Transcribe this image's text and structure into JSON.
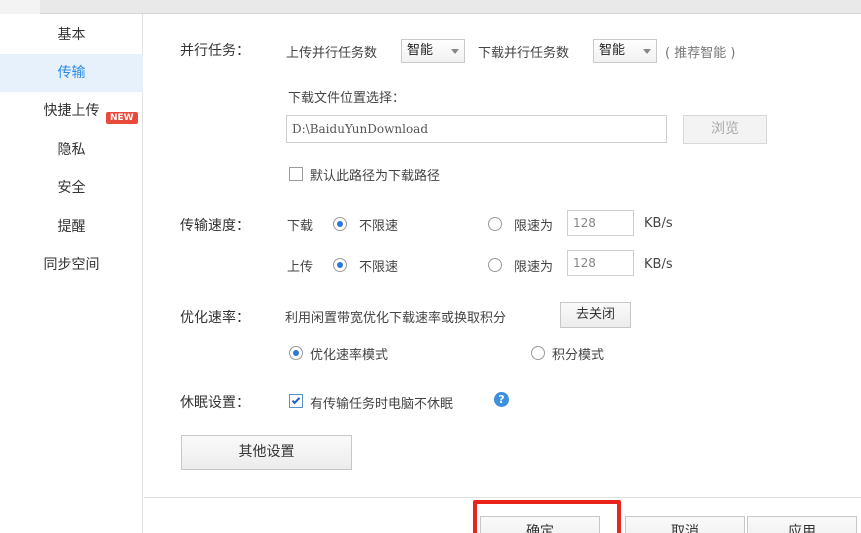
{
  "sidebar": {
    "items": [
      {
        "label": "基本"
      },
      {
        "label": "传输",
        "active": true
      },
      {
        "label": "快捷上传",
        "badge": "NEW"
      },
      {
        "label": "隐私"
      },
      {
        "label": "安全"
      },
      {
        "label": "提醒"
      },
      {
        "label": "同步空间"
      }
    ]
  },
  "parallel": {
    "label": "并行任务：",
    "upload_label": "上传并行任务数",
    "upload_value": "智能",
    "download_label": "下载并行任务数",
    "download_value": "智能",
    "hint": "( 推荐智能 )"
  },
  "download_location": {
    "label": "下载文件位置选择：",
    "path": "D:\\BaiduYunDownload",
    "browse_button": "浏览",
    "default_checkbox_label": "默认此路径为下载路径",
    "default_checked": false
  },
  "speed": {
    "label": "传输速度：",
    "download_label": "下载",
    "upload_label": "上传",
    "unlimited_label": "不限速",
    "limit_label": "限速为",
    "download_limit_value": "128",
    "upload_limit_value": "128",
    "unit": "KB/s",
    "download_selected": "unlimited",
    "upload_selected": "unlimited"
  },
  "optimize": {
    "label": "优化速率：",
    "description": "利用闲置带宽优化下载速率或换取积分",
    "close_button": "去关闭",
    "mode_speed_label": "优化速率模式",
    "mode_points_label": "积分模式",
    "selected": "speed"
  },
  "sleep": {
    "label": "休眠设置：",
    "checkbox_label": "有传输任务时电脑不休眠",
    "checked": true,
    "help_icon": "question-circle-icon"
  },
  "other_settings_button": "其他设置",
  "footer": {
    "ok_button": "确定",
    "cancel_button": "取消",
    "apply_button": "应用"
  },
  "colors": {
    "accent": "#2a8ce6",
    "active_bg": "#e7f1fc",
    "highlight": "#e8231b",
    "badge": "#e84b3c"
  }
}
